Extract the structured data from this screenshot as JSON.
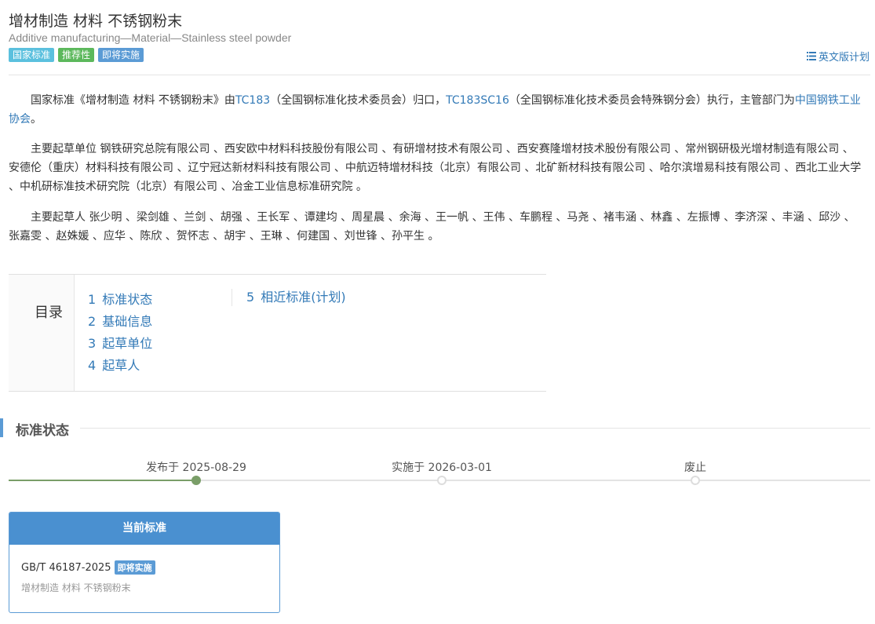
{
  "header": {
    "title": "增材制造 材料 不锈钢粉末",
    "subtitle": "Additive manufacturing—Material—Stainless steel powder",
    "badges": [
      "国家标准",
      "推荐性",
      "即将实施"
    ],
    "english_plan": "英文版计划",
    "english_plan_icon": "list-icon"
  },
  "intro": {
    "p1_a": "国家标准《增材制造 材料 不锈钢粉末》由",
    "tc183": "TC183",
    "p1_b": "（全国钢标准化技术委员会）归口，",
    "tc183sc16": "TC183SC16",
    "p1_c": "（全国钢标准化技术委员会特殊钢分会）执行，主管部门为",
    "dept": "中国钢铁工业协会",
    "p1_d": "。",
    "drafting_units": "主要起草单位 钢铁研究总院有限公司 、西安欧中材料科技股份有限公司 、有研增材技术有限公司 、西安赛隆增材技术股份有限公司 、常州钢研极光增材制造有限公司 、安德伦（重庆）材料科技有限公司 、辽宁冠达新材料科技有限公司 、中航迈特增材科技（北京）有限公司 、北矿新材科技有限公司 、哈尔滨增易科技有限公司 、西北工业大学 、中机研标准技术研究院（北京）有限公司 、冶金工业信息标准研究院 。",
    "drafters": "主要起草人 张少明 、梁剑雄 、兰剑 、胡强 、王长军 、谭建均 、周星晨 、余海 、王一帆 、王伟 、车鹏程 、马尧 、褚韦涵 、林鑫 、左振博 、李济深 、丰涵 、邱沙 、张嘉雯 、赵姝媛 、应华 、陈欣 、贺怀志 、胡宇 、王琳 、何建国 、刘世锋 、孙平生 。"
  },
  "toc": {
    "heading": "目录",
    "items": [
      {
        "num": "1",
        "label": "标准状态"
      },
      {
        "num": "2",
        "label": "基础信息"
      },
      {
        "num": "3",
        "label": "起草单位"
      },
      {
        "num": "4",
        "label": "起草人"
      },
      {
        "num": "5",
        "label": "相近标准(计划)"
      }
    ]
  },
  "status_section": {
    "title": "标准状态",
    "timeline": [
      {
        "label": "发布于 2025-08-29",
        "active": true
      },
      {
        "label": "实施于 2026-03-01",
        "active": false
      },
      {
        "label": "废止",
        "active": false
      }
    ]
  },
  "current_standard": {
    "header": "当前标准",
    "code": "GB/T 46187-2025",
    "badge": "即将实施",
    "name": "增材制造 材料 不锈钢粉末"
  },
  "colors": {
    "link": "#337ab7",
    "accent": "#5b9bd5",
    "timeline_done": "#7a9e68"
  }
}
